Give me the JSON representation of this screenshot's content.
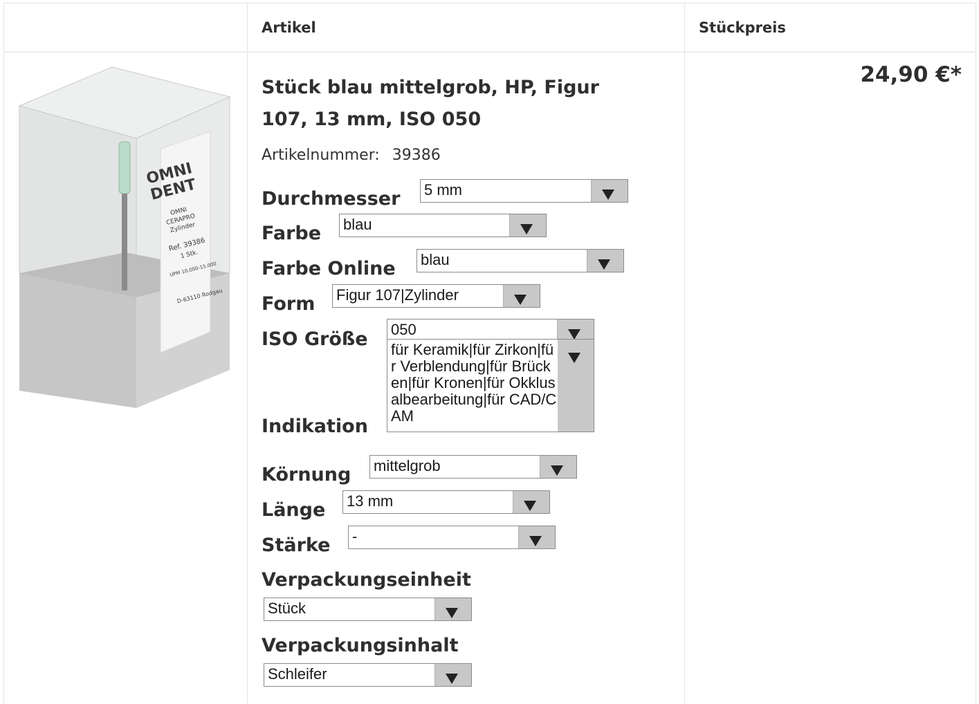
{
  "table": {
    "col_article": "Artikel",
    "col_unit_price": "Stückpreis"
  },
  "product": {
    "title": "Stück blau mittelgrob, HP, Figur 107, 13 mm, ISO 050",
    "article_number_label": "Artikelnummer:",
    "article_number": "39386",
    "price": "24,90 €*",
    "image_label": {
      "brand_line1": "OMNI",
      "brand_line2": "DENT",
      "line1": "OMNI",
      "line2": "CERAPRO",
      "line3": "Zylinder",
      "ref": "Ref. 39386",
      "qty": "1 Stk.",
      "upm": "UPM 10.000-15.000",
      "address": "D-63110 Rodgau"
    }
  },
  "attributes": {
    "durchmesser": {
      "label": "Durchmesser",
      "value": "5 mm"
    },
    "farbe": {
      "label": "Farbe",
      "value": "blau"
    },
    "farbe_online": {
      "label": "Farbe Online",
      "value": "blau"
    },
    "form": {
      "label": "Form",
      "value": "Figur 107|Zylinder"
    },
    "iso_groesse": {
      "label": "ISO Größe",
      "value": "050"
    },
    "indikation": {
      "label": "Indikation",
      "value": "für Keramik|für Zirkon|für Verblendung|für Brücken|für Kronen|für Okklusalbearbeitung|für CAD/CAM"
    },
    "koernung": {
      "label": "Körnung",
      "value": "mittelgrob"
    },
    "laenge": {
      "label": "Länge",
      "value": "13 mm"
    },
    "staerke": {
      "label": "Stärke",
      "value": "-"
    },
    "verpackungseinheit": {
      "label": "Verpackungseinheit",
      "value": "Stück"
    },
    "verpackungsinhalt": {
      "label": "Verpackungsinhalt",
      "value": "Schleifer"
    }
  },
  "colors": {
    "border": "#e3e3e3",
    "select_arrow_bg": "#c8c8c8",
    "text": "#2f2f2f"
  }
}
